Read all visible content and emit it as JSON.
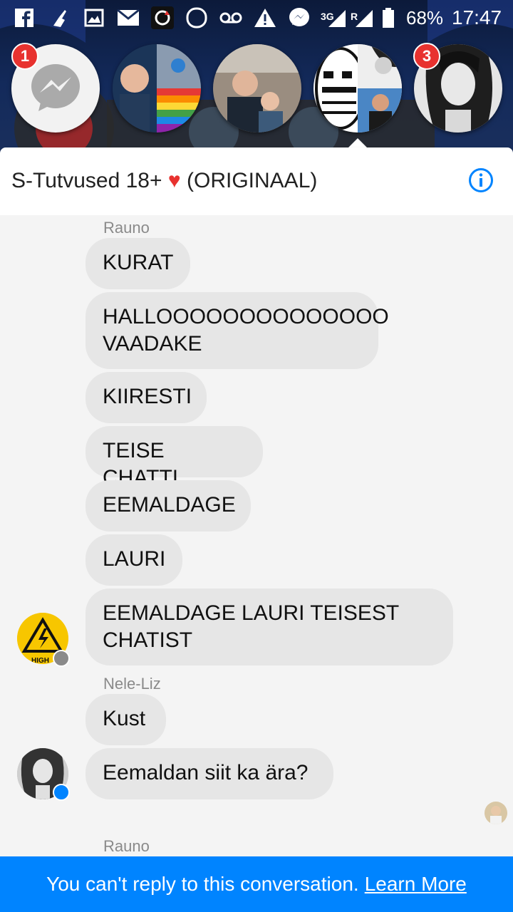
{
  "status_bar": {
    "icons": [
      "facebook-icon",
      "cleaner-icon",
      "image-icon",
      "mail-icon",
      "sync-icon",
      "circle-icon",
      "voicemail-icon",
      "warning-icon",
      "messenger-icon",
      "network-3g-icon",
      "signal-icon",
      "battery-icon"
    ],
    "network_label": "3G",
    "roaming_label": "R",
    "battery": "68%",
    "time": "17:47"
  },
  "chat_heads": {
    "messenger_badge": "1",
    "last_badge": "3"
  },
  "header": {
    "title": "S-Tutvused 18+",
    "heart": "♥",
    "subtitle": "(ORIGINAAL)"
  },
  "messages": {
    "sender_1": "Rauno",
    "m1": "KURAT",
    "m2": "HALLOOOOOOOOOOOOOO\nVAADAKE",
    "m3": "KIIRESTI",
    "m4": "TEISE CHATTI",
    "m5": "EEMALDAGE",
    "m6": "LAURI",
    "m7": "EEMALDAGE LAURI TEISEST\nCHATIST",
    "avatar_text": "HIGH",
    "sender_2": "Nele-Liz",
    "m8": "Kust",
    "m9": "Eemaldan siit ka ära?",
    "sender_3": "Rauno"
  },
  "footer": {
    "text": "You can't reply to this conversation.",
    "link": "Learn More"
  },
  "colors": {
    "accent": "#0084ff",
    "badge": "#e8322f",
    "bubble": "#e6e6e6",
    "background": "#f4f4f4"
  }
}
